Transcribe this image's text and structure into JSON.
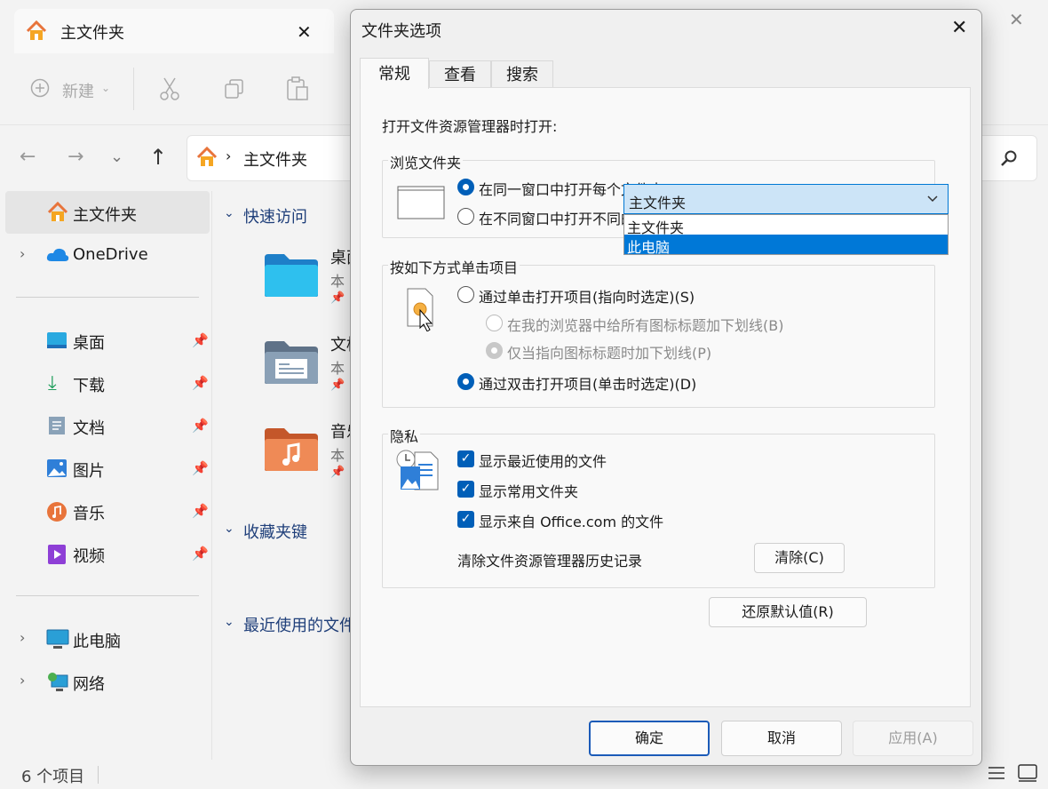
{
  "window": {
    "tab_title": "主文件夹",
    "toolbar": {
      "new_label": "新建"
    },
    "address": {
      "path": "主文件夹"
    },
    "sidebar": {
      "home": "主文件夹",
      "onedrive": "OneDrive",
      "pinned": [
        "桌面",
        "下载",
        "文档",
        "图片",
        "音乐",
        "视频"
      ],
      "this_pc": "此电脑",
      "network": "网络"
    },
    "sections": {
      "quick_access": "快速访问",
      "favorites": "收藏夹键",
      "recent": "最近使用的文件"
    },
    "items": [
      {
        "name": "桌面",
        "sub": "本"
      },
      {
        "name": "文档",
        "sub": "本"
      },
      {
        "name": "音乐",
        "sub": "本"
      }
    ],
    "status": "6 个项目"
  },
  "dialog": {
    "title": "文件夹选项",
    "tabs": [
      "常规",
      "查看",
      "搜索"
    ],
    "open_label": "打开文件资源管理器时打开:",
    "combo_value": "主文件夹",
    "dropdown_options": [
      "主文件夹",
      "此电脑"
    ],
    "browse": {
      "legend": "浏览文件夹",
      "same_window": "在同一窗口中打开每个文件夹(M)",
      "new_window": "在不同窗口中打开不同的文件夹(W)"
    },
    "click": {
      "legend": "按如下方式单击项目",
      "single": "通过单击打开项目(指向时选定)(S)",
      "underline_all": "在我的浏览器中给所有图标标题加下划线(B)",
      "underline_point": "仅当指向图标标题时加下划线(P)",
      "double": "通过双击打开项目(单击时选定)(D)"
    },
    "privacy": {
      "legend": "隐私",
      "recent_files": "显示最近使用的文件",
      "frequent_folders": "显示常用文件夹",
      "office_files": "显示来自 Office.com 的文件",
      "clear_label": "清除文件资源管理器历史记录",
      "clear_button": "清除(C)"
    },
    "restore_button": "还原默认值(R)",
    "ok": "确定",
    "cancel": "取消",
    "apply": "应用(A)"
  }
}
